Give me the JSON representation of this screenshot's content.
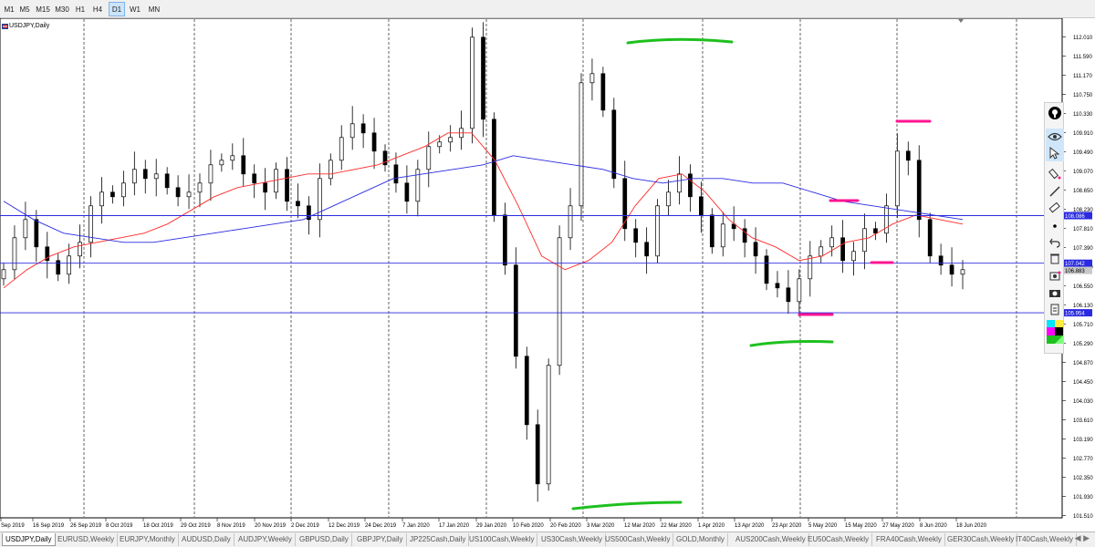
{
  "timeframes": [
    "M1",
    "M5",
    "M15",
    "M30",
    "H1",
    "H4",
    "D1",
    "W1",
    "MN"
  ],
  "active_timeframe": "D1",
  "chart": {
    "symbol_title": "USDJPY,Daily",
    "price_axis_labels": [
      "112.010",
      "111.590",
      "111.170",
      "110.750",
      "110.330",
      "109.910",
      "109.490",
      "109.070",
      "108.650",
      "108.230",
      "107.810",
      "107.390",
      "106.970",
      "106.550",
      "106.130",
      "105.710",
      "105.290",
      "104.870",
      "104.450",
      "104.030",
      "103.610",
      "103.190",
      "102.770",
      "102.350",
      "101.930",
      "101.510"
    ],
    "date_axis_labels": [
      "Sep 2019",
      "16 Sep 2019",
      "26 Sep 2019",
      "8 Oct 2019",
      "18 Oct 2019",
      "29 Oct 2019",
      "8 Nov 2019",
      "20 Nov 2019",
      "2 Dec 2019",
      "12 Dec 2019",
      "24 Dec 2019",
      "7 Jan 2020",
      "17 Jan 2020",
      "29 Jan 2020",
      "10 Feb 2020",
      "20 Feb 2020",
      "3 Mar 2020",
      "12 Mar 2020",
      "22 Mar 2020",
      "1 Apr 2020",
      "13 Apr 2020",
      "23 Apr 2020",
      "5 May 2020",
      "15 May 2020",
      "27 May 2020",
      "8 Jun 2020",
      "18 Jun 2020"
    ],
    "horizontal_levels": [
      {
        "price": "108.086",
        "color": "#2a2ae0"
      },
      {
        "price": "107.042",
        "color": "#2a2ae0"
      },
      {
        "price": "105.954",
        "color": "#2a2ae0"
      }
    ],
    "current_price_label": "106.883",
    "colors": {
      "up_candle": "#ffffff",
      "down_candle": "#000000",
      "fast_ma": "#ff2a2a",
      "slow_ma": "#2a2ae0",
      "resistance_marker": "#ff1493",
      "support_marker": "#1ec01e",
      "level_label_bg": "#2a2ae0"
    }
  },
  "chart_data": {
    "type": "candlestick",
    "title": "USDJPY,Daily",
    "ylim": [
      101.3,
      112.3
    ],
    "x": [
      "Sep 2019",
      "16 Sep 2019",
      "26 Sep 2019",
      "8 Oct 2019",
      "18 Oct 2019",
      "29 Oct 2019",
      "8 Nov 2019",
      "20 Nov 2019",
      "2 Dec 2019",
      "12 Dec 2019",
      "24 Dec 2019",
      "7 Jan 2020",
      "17 Jan 2020",
      "29 Jan 2020",
      "10 Feb 2020",
      "20 Feb 2020",
      "3 Mar 2020",
      "12 Mar 2020",
      "22 Mar 2020",
      "1 Apr 2020",
      "13 Apr 2020",
      "23 Apr 2020",
      "5 May 2020",
      "15 May 2020",
      "27 May 2020",
      "8 Jun 2020",
      "18 Jun 2020"
    ],
    "close_trace": [
      106.9,
      107.6,
      108.0,
      107.4,
      107.1,
      106.8,
      107.2,
      107.5,
      108.3,
      108.6,
      108.5,
      108.8,
      109.1,
      108.9,
      109.0,
      108.7,
      108.5,
      108.6,
      108.8,
      109.2,
      109.3,
      109.4,
      109.0,
      108.8,
      108.6,
      109.1,
      108.4,
      108.3,
      108.0,
      108.9,
      109.3,
      109.8,
      110.1,
      109.9,
      109.5,
      109.2,
      108.8,
      108.4,
      109.1,
      109.6,
      109.7,
      109.8,
      110.0,
      112.0,
      110.2,
      108.1,
      107.0,
      105.0,
      103.5,
      102.2,
      104.8,
      107.6,
      108.3,
      111.0,
      111.2,
      110.4,
      108.9,
      107.8,
      107.5,
      107.2,
      108.3,
      108.6,
      109.0,
      108.5,
      108.1,
      107.4,
      107.9,
      107.8,
      107.5,
      107.2,
      106.6,
      106.5,
      106.2,
      106.7,
      107.2,
      107.4,
      107.6,
      107.1,
      107.3,
      107.8,
      107.7,
      108.3,
      109.5,
      109.3,
      108.0,
      107.2,
      107.0,
      106.8,
      106.9
    ],
    "series": [
      {
        "name": "fast_ma",
        "values": [
          106.5,
          106.9,
          107.2,
          107.4,
          107.5,
          107.6,
          107.7,
          107.9,
          108.2,
          108.5,
          108.7,
          108.8,
          108.9,
          109.0,
          109.0,
          109.1,
          109.2,
          109.4,
          109.6,
          109.9,
          109.9,
          109.3,
          108.3,
          107.2,
          106.9,
          107.1,
          107.5,
          108.3,
          108.9,
          109.0,
          108.6,
          108.0,
          107.6,
          107.4,
          107.1,
          107.2,
          107.5,
          107.6,
          107.9,
          108.1,
          108.0,
          107.9
        ]
      },
      {
        "name": "slow_ma",
        "values": [
          108.4,
          108.0,
          107.7,
          107.6,
          107.5,
          107.5,
          107.6,
          107.7,
          107.8,
          107.9,
          108.0,
          108.3,
          108.6,
          108.9,
          109.0,
          109.1,
          109.2,
          109.4,
          109.3,
          109.2,
          109.1,
          108.9,
          108.8,
          108.9,
          108.9,
          108.8,
          108.8,
          108.6,
          108.4,
          108.3,
          108.2,
          108.1,
          108.0
        ]
      }
    ]
  },
  "side_toolbar": {
    "items": [
      "pin-icon",
      "eye-icon",
      "cursor-icon",
      "brush-icon",
      "line-icon",
      "eraser-icon",
      "dot-icon",
      "undo-icon",
      "trash-icon",
      "screenshot-icon",
      "camera-icon",
      "clipboard-icon",
      "palette-icon"
    ]
  },
  "tabs": [
    "USDJPY,Daily",
    "EURUSD,Weekly",
    "EURJPY,Monthly",
    "AUDUSD,Daily",
    "AUDJPY,Weekly",
    "GBPUSD,Daily",
    "GBPJPY,Daily",
    "JP225Cash,Daily",
    "US100Cash,Weekly",
    "US30Cash,Weekly",
    "US500Cash,Weekly",
    "GOLD,Monthly",
    "AUS200Cash,Weekly",
    "EU50Cash,Weekly",
    "FRA40Cash,Weekly",
    "GER30Cash,Weekly",
    "IT40Cash,Weekly"
  ],
  "active_tab": "USDJPY,Daily"
}
